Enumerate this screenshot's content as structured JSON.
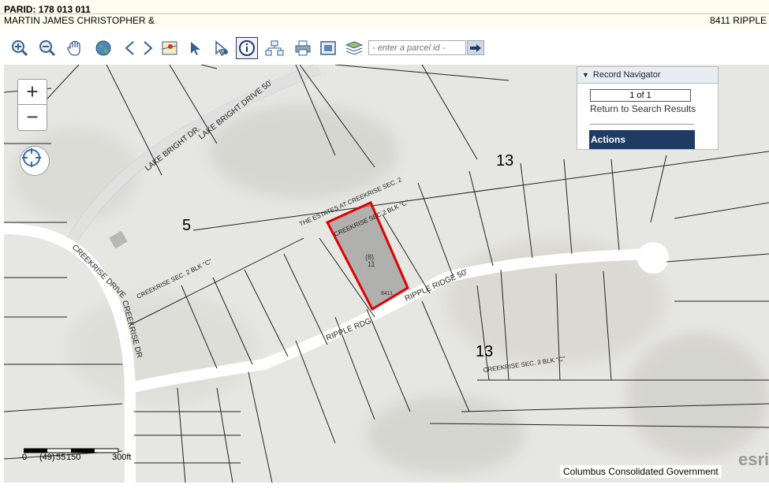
{
  "header": {
    "parid": "PARID: 178 013 011",
    "owner": "MARTIN JAMES CHRISTOPHER &",
    "address": "8411 RIPPLE"
  },
  "toolbar": {
    "tools": [
      {
        "name": "zoom-in-icon"
      },
      {
        "name": "zoom-out-icon"
      },
      {
        "name": "pan-hand-icon"
      },
      {
        "name": "globe-icon"
      },
      {
        "name": "back-arrow-icon"
      },
      {
        "name": "forward-arrow-icon"
      },
      {
        "name": "map-overview-icon"
      },
      {
        "name": "select-arrow-icon"
      },
      {
        "name": "select-point-icon"
      },
      {
        "name": "info-icon",
        "active": true
      },
      {
        "name": "hierarchy-icon"
      },
      {
        "name": "print-icon"
      },
      {
        "name": "fullscreen-icon"
      },
      {
        "name": "layers-icon"
      }
    ],
    "search_placeholder": "- enter a parcel id -"
  },
  "record_navigator": {
    "title": "Record Navigator",
    "record": "1 of 1",
    "return_link": "Return to Search Results",
    "actions": "Actions"
  },
  "map": {
    "roads": [
      "LAKE BRIGHT DR.",
      "LAKE BRIGHT DRIVE  50'",
      "CREEKRISE DRIVE",
      "CREEKRISE DR",
      "RIPPLE RIDGE  50'",
      "RIPPLE RDG"
    ],
    "subdivisions": [
      "THE ESTATES AT CREEKRISE SEC. 2",
      "CREEKRISE SEC 2 BLK \"C\"",
      "CREEKRISE SEC. 2 BLK \"C\"",
      "CREEKRISE SEC. 3  BLK \"C\""
    ],
    "block_numbers": [
      "13",
      "5",
      "13"
    ],
    "selected_parcel": {
      "label": "(8)",
      "lot": "11",
      "house": "8411"
    },
    "scale": {
      "labels": [
        "0",
        "(49)",
        "55",
        "150",
        "300ft"
      ]
    },
    "attribution": "Columbus Consolidated Government",
    "logo": "esri"
  }
}
